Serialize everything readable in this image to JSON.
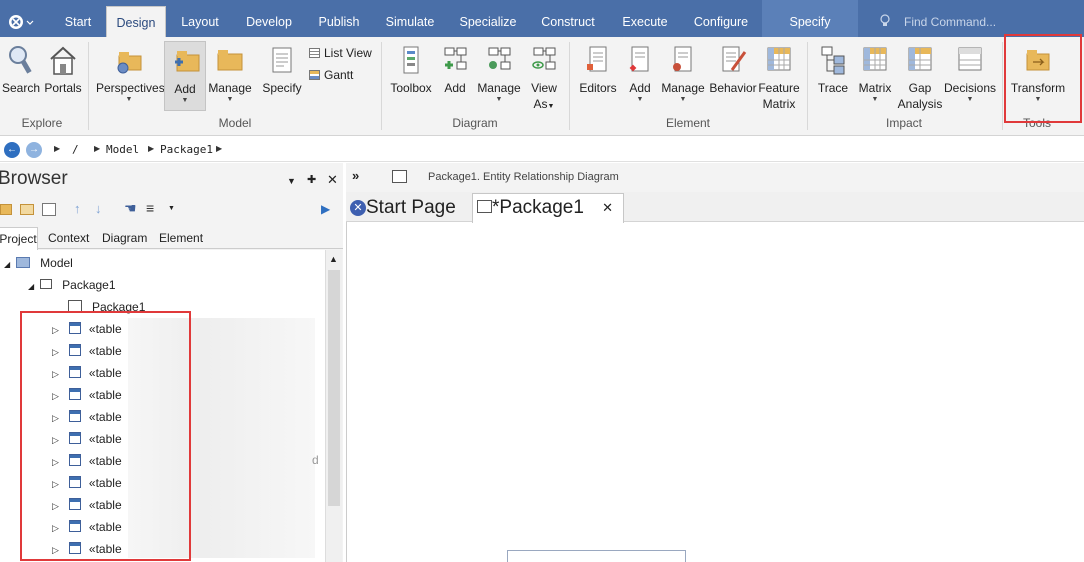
{
  "menu": {
    "app_icon": "ea-logo-icon",
    "tabs": [
      "Start",
      "Design",
      "Layout",
      "Develop",
      "Publish",
      "Simulate",
      "Specialize",
      "Construct",
      "Execute",
      "Configure",
      "Specify"
    ],
    "active_tab": "Design",
    "find_placeholder": "Find Command..."
  },
  "ribbon": {
    "explore": {
      "label": "Explore",
      "search": "Search",
      "portals": "Portals"
    },
    "model": {
      "label": "Model",
      "perspectives": "Perspectives",
      "add": "Add",
      "manage": "Manage",
      "specify": "Specify",
      "list_view": "List View",
      "gantt": "Gantt"
    },
    "diagram": {
      "label": "Diagram",
      "toolbox": "Toolbox",
      "add": "Add",
      "manage": "Manage",
      "view_line1": "View",
      "view_line2": "As"
    },
    "element": {
      "label": "Element",
      "editors": "Editors",
      "add": "Add",
      "manage": "Manage",
      "behavior": "Behavior",
      "feature_line1": "Feature",
      "feature_line2": "Matrix"
    },
    "impact": {
      "label": "Impact",
      "trace": "Trace",
      "matrix": "Matrix",
      "gap_line1": "Gap",
      "gap_line2": "Analysis",
      "decisions": "Decisions"
    },
    "tools": {
      "label": "Tools",
      "transform": "Transform"
    }
  },
  "pathbar": {
    "sep": "/",
    "model": "Model",
    "package": "Package1"
  },
  "browser": {
    "title": "Browser",
    "tabs": [
      "Project",
      "Context",
      "Diagram",
      "Element"
    ],
    "active_tab": "Project",
    "tree": {
      "model": "Model",
      "package": "Package1",
      "diagram": "Package1"
    },
    "tables": [
      "«table",
      "«table",
      "«table",
      "«table",
      "«table",
      "«table",
      "«table",
      "«table",
      "«table",
      "«table",
      "«table"
    ],
    "stray_char": "d"
  },
  "diagram": {
    "breadcrumb": "Package1.  Entity Relationship Diagram",
    "tabs": {
      "start": "Start Page",
      "package": "*Package1"
    },
    "close_glyph": "✕"
  },
  "colors": {
    "title_bar": "#4a6fa8",
    "highlight": "#e0393a",
    "ribbon_bg": "#f3f3f3"
  }
}
